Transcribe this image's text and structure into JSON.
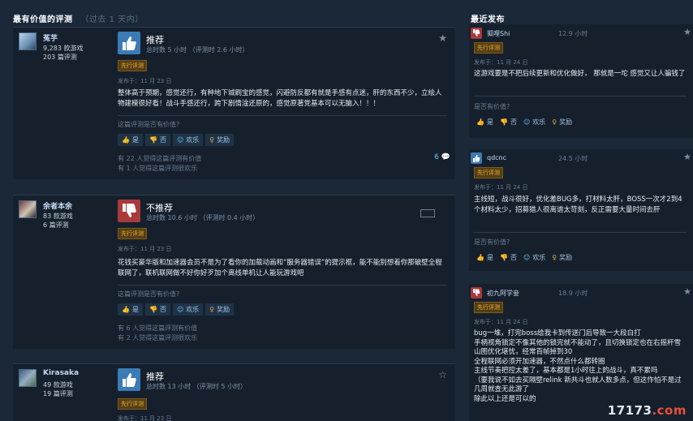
{
  "left_header": {
    "title": "最有价值的评测",
    "subtitle": "（过去 1 天内）"
  },
  "right_header": {
    "title": "最近发布"
  },
  "colors": {
    "background": "#1b2838",
    "recommend": "#3b7bb6",
    "not_recommend": "#a93a3a",
    "early_access_tag": "#e8b33d",
    "link": "#67c1f5"
  },
  "buttons": {
    "yes": "是",
    "no": "否",
    "funny": "欢乐",
    "award": "奖励"
  },
  "reviews": [
    {
      "user": "菟芋",
      "games": "9,283 款游戏",
      "reviews_count": "203 篇评测",
      "verdict": "推荐",
      "vote": "up",
      "hours": "总时数 5 小时  （评测时 2.6 小时）",
      "tag": "先行评测",
      "posted": "发布于：11 月 23 日",
      "body": "整体高于预期，感觉还行，有种地下城刷宝的感觉，闪避防反都有就是手感有点迷，肝的东西不少，立绘人物建模很好看！战斗手感还行，跨下剧情淦还原的，感觉原著党基本可以无脑入！！！",
      "helpful_question": "这篇评测是否有价值?",
      "helpful_line1": "有 22 人觉得这篇评测有价值",
      "helpful_line2": "有 1 人觉得这篇评测很欢乐",
      "comments": "6"
    },
    {
      "user": "余者本余",
      "games": "83 款游戏",
      "reviews_count": "6 篇评测",
      "verdict": "不推荐",
      "vote": "down",
      "hours": "总时数 10.6 小时  （评测时 0.4 小时）",
      "tag": "先行评测",
      "posted": "发布于：11 月 23 日",
      "body": "花钱买豪华版和加速器会员不是为了看你的加载动画和“服务器错误”的提示框，能不能别想着你那破壁全程联网了，联机联网做不好你好歹加个离线单机让人能玩游戏吧",
      "helpful_question": "这篇评测是否有价值?",
      "helpful_line1": "有 6 人觉得这篇评测有价值",
      "helpful_line2": "有 2 人觉得这篇评测很欢乐"
    },
    {
      "user": "Kirasaka",
      "games": "49 款游戏",
      "reviews_count": "19 篇评测",
      "verdict": "推荐",
      "vote": "up",
      "hours": "总时数 13 小时  （评测时 5 小时）",
      "tag": "先行评测",
      "posted": "发布于：11 月 23 日"
    }
  ],
  "recent": [
    {
      "user": "狐哩Shi",
      "hours": "12.9 小时",
      "vote": "down",
      "tag": "先行评测",
      "posted": "发布于：11 月 24 日",
      "body": "这游戏要是不把后续更新和优化做好，  那就是一坨  感觉又让人骗钱了",
      "helpful_question": "是否有价值?"
    },
    {
      "user": "qdcnc",
      "hours": "24.5 小时",
      "vote": "up",
      "tag": "先行评测",
      "posted": "发布于：11 月 24 日",
      "body": "主线短，战斗很好，优化差BUG多，打材料太肝，BOSS一次才2到4个材料太少，招募猎人很离谱太苛刻，反正需要大量时间去肝",
      "helpful_question": "是否有价值?"
    },
    {
      "user": "初九阿学妾",
      "hours": "18.9 小时",
      "vote": "down",
      "tag": "先行评测",
      "posted": "发布于：11 月 24 日",
      "body_lines": [
        "bug一堆，打完boss给我卡到传送门后导致一大段白打",
        "手柄视角锁定不像其他的锁完就不能动了，且切换锁定也在右摇杆雪山图优化堪忧，经常百帧掉到30",
        "全程联网必须开加速器，不然点什么都转圈",
        "主线节奏把控太差了，基本都是1小时往上的战斗，真不累吗",
        "（要我说不如去买隔壁relink 新共斗也就人数多点，但这作怕不是过几周就查无此游了",
        "除此以上还是可以的"
      ]
    }
  ],
  "watermark": {
    "text": "17173",
    "suffix": ".com"
  }
}
